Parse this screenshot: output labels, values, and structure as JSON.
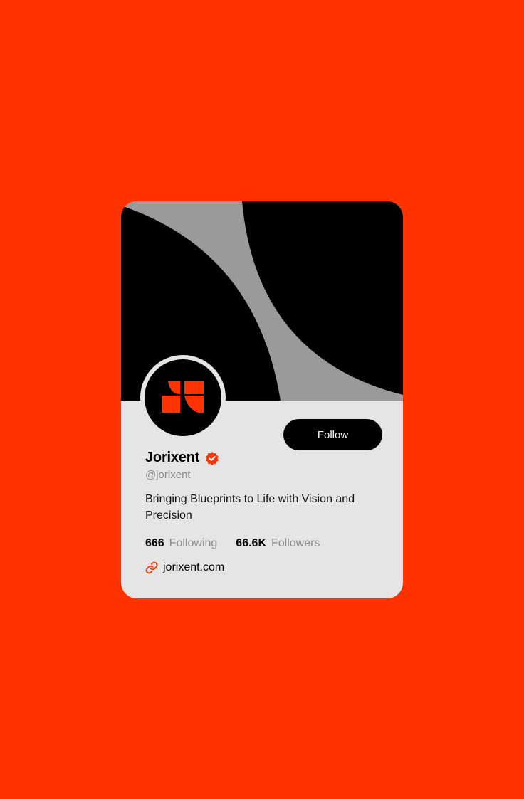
{
  "colors": {
    "background": "#ff3300",
    "card": "#e5e5e5",
    "cover_dark": "#000000",
    "cover_gray": "#9a9a9a",
    "accent": "#ff3300"
  },
  "profile": {
    "name": "Jorixent",
    "handle": "@jorixent",
    "bio": "Bringing Blueprints to Life with Vision and Precision",
    "verified_icon": "verified-badge-icon",
    "avatar_icon": "brand-logo-icon"
  },
  "actions": {
    "follow_label": "Follow"
  },
  "stats": {
    "following_count": "666",
    "following_label": "Following",
    "followers_count": "66.6K",
    "followers_label": "Followers"
  },
  "link": {
    "icon": "link-icon",
    "text": "jorixent.com"
  }
}
